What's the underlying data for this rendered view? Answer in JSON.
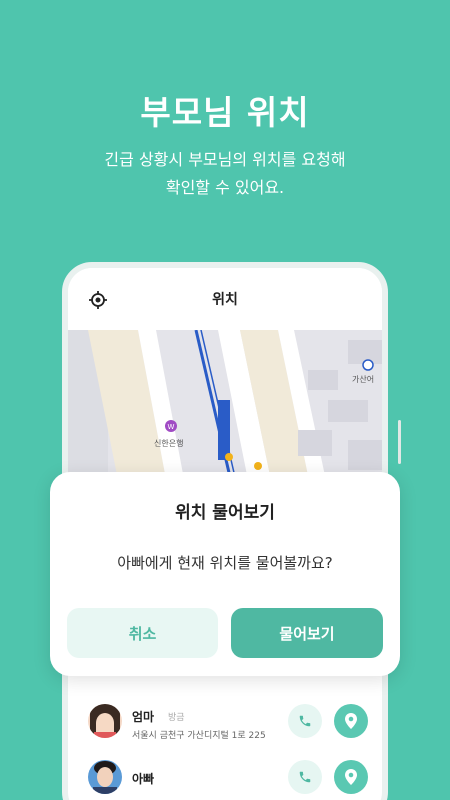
{
  "promo": {
    "title": "부모님 위치",
    "subtitle_line1": "긴급 상황시 부모님의 위치를 요청해",
    "subtitle_line2": "확인할 수 있어요."
  },
  "app": {
    "header_title": "위치",
    "map": {
      "poi_bank": "신한은행",
      "poi_gasan": "가산어"
    },
    "contacts": [
      {
        "name": "엄마",
        "tag": "방금",
        "address": "서울시 금천구 가산디지털 1로 225"
      },
      {
        "name": "아빠",
        "tag": "",
        "address": ""
      }
    ]
  },
  "dialog": {
    "title": "위치 물어보기",
    "message": "아빠에게 현재 위치를 물어볼까요?",
    "cancel_label": "취소",
    "confirm_label": "물어보기"
  },
  "colors": {
    "background": "#4fc5ad",
    "accent": "#4fb8a2",
    "accent_light": "#e8f7f3"
  },
  "icons": [
    "locate-icon",
    "phone-icon",
    "map-pin-icon"
  ]
}
